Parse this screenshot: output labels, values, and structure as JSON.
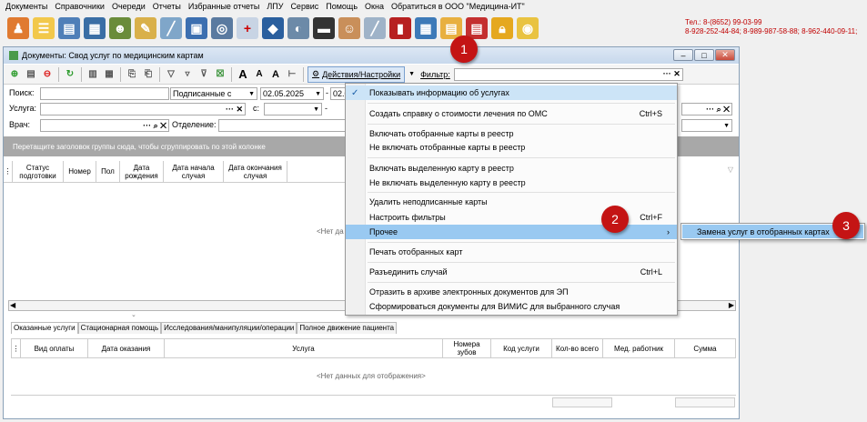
{
  "menubar": [
    "Документы",
    "Справочники",
    "Очереди",
    "Отчеты",
    "Избранные отчеты",
    "ЛПУ",
    "Сервис",
    "Помощь",
    "Окна",
    "Обратиться в ООО \"Медицина-ИТ\""
  ],
  "contacts": {
    "line1": "Тел.: 8-(8652) 99-03-99",
    "line2": "8-928-252-44-84; 8-989-987-58-88; 8-962-440-09-11;"
  },
  "window": {
    "title": "Документы: Свод услуг по медицинским картам"
  },
  "toolbar": {
    "actions_label": "Действия/Настройки",
    "filter_label": "Фильтр:",
    "font_a1": "A",
    "font_a2": "A",
    "font_a3": "A"
  },
  "filters": {
    "search_label": "Поиск:",
    "signed_value": "Подписанные с",
    "date_from": "02.05.2025",
    "date_to_prefix": "02.0",
    "service_label": "Услуга:",
    "c_label": "с:",
    "doctor_label": "Врач:",
    "department_label": "Отделение:"
  },
  "grid": {
    "group_hint": "Перетащите заголовок группы сюда, чтобы сгруппировать по этой колонке",
    "columns": [
      "Статус подготовки",
      "Номер",
      "Пол",
      "Дата рождения",
      "Дата начала случая",
      "Дата окончания случая"
    ],
    "empty_partial": "<Нет да"
  },
  "tabs": [
    "Оказанные услуги",
    "Стационарная помощь",
    "Исследования/манипуляции/операции",
    "Полное движение пациента"
  ],
  "services_grid": {
    "columns": [
      "Вид оплаты",
      "Дата оказания",
      "Услуга",
      "Номера зубов",
      "Код услуги",
      "Кол-во всего",
      "Мед. работник",
      "Сумма"
    ],
    "empty": "<Нет данных для отображения>"
  },
  "menu": [
    {
      "label": "Показывать информацию об услугах",
      "checked": true,
      "shortcut": ""
    },
    {
      "label": "Создать справку о стоимости лечения по ОМС",
      "shortcut": "Ctrl+S"
    },
    {
      "label": "Включать отобранные карты в реестр",
      "shortcut": ""
    },
    {
      "label": "Не включать отобранные карты в реестр",
      "shortcut": ""
    },
    {
      "label": "Включать выделенную карту в реестр",
      "shortcut": ""
    },
    {
      "label": "Не включать выделенную карту в реестр",
      "shortcut": ""
    },
    {
      "label": "Удалить неподписанные карты",
      "shortcut": ""
    },
    {
      "label": "Настроить фильтры",
      "shortcut": "Ctrl+F"
    },
    {
      "label": "Прочее",
      "shortcut": "›"
    },
    {
      "label": "Печать отобранных карт",
      "shortcut": ""
    },
    {
      "label": "Разъединить случай",
      "shortcut": "Ctrl+L"
    },
    {
      "label": "Отразить в архиве электронных документов для ЭП",
      "shortcut": ""
    },
    {
      "label": "Сформироваться документы для ВИМИС для выбранного случая",
      "shortcut": ""
    }
  ],
  "submenu": {
    "label": "Замена услуг в отобранных картах"
  },
  "badges": [
    "1",
    "2",
    "3"
  ],
  "colors": {
    "accent": "#99c9f1",
    "badge": "#c41414",
    "contacts": "#c00000"
  }
}
